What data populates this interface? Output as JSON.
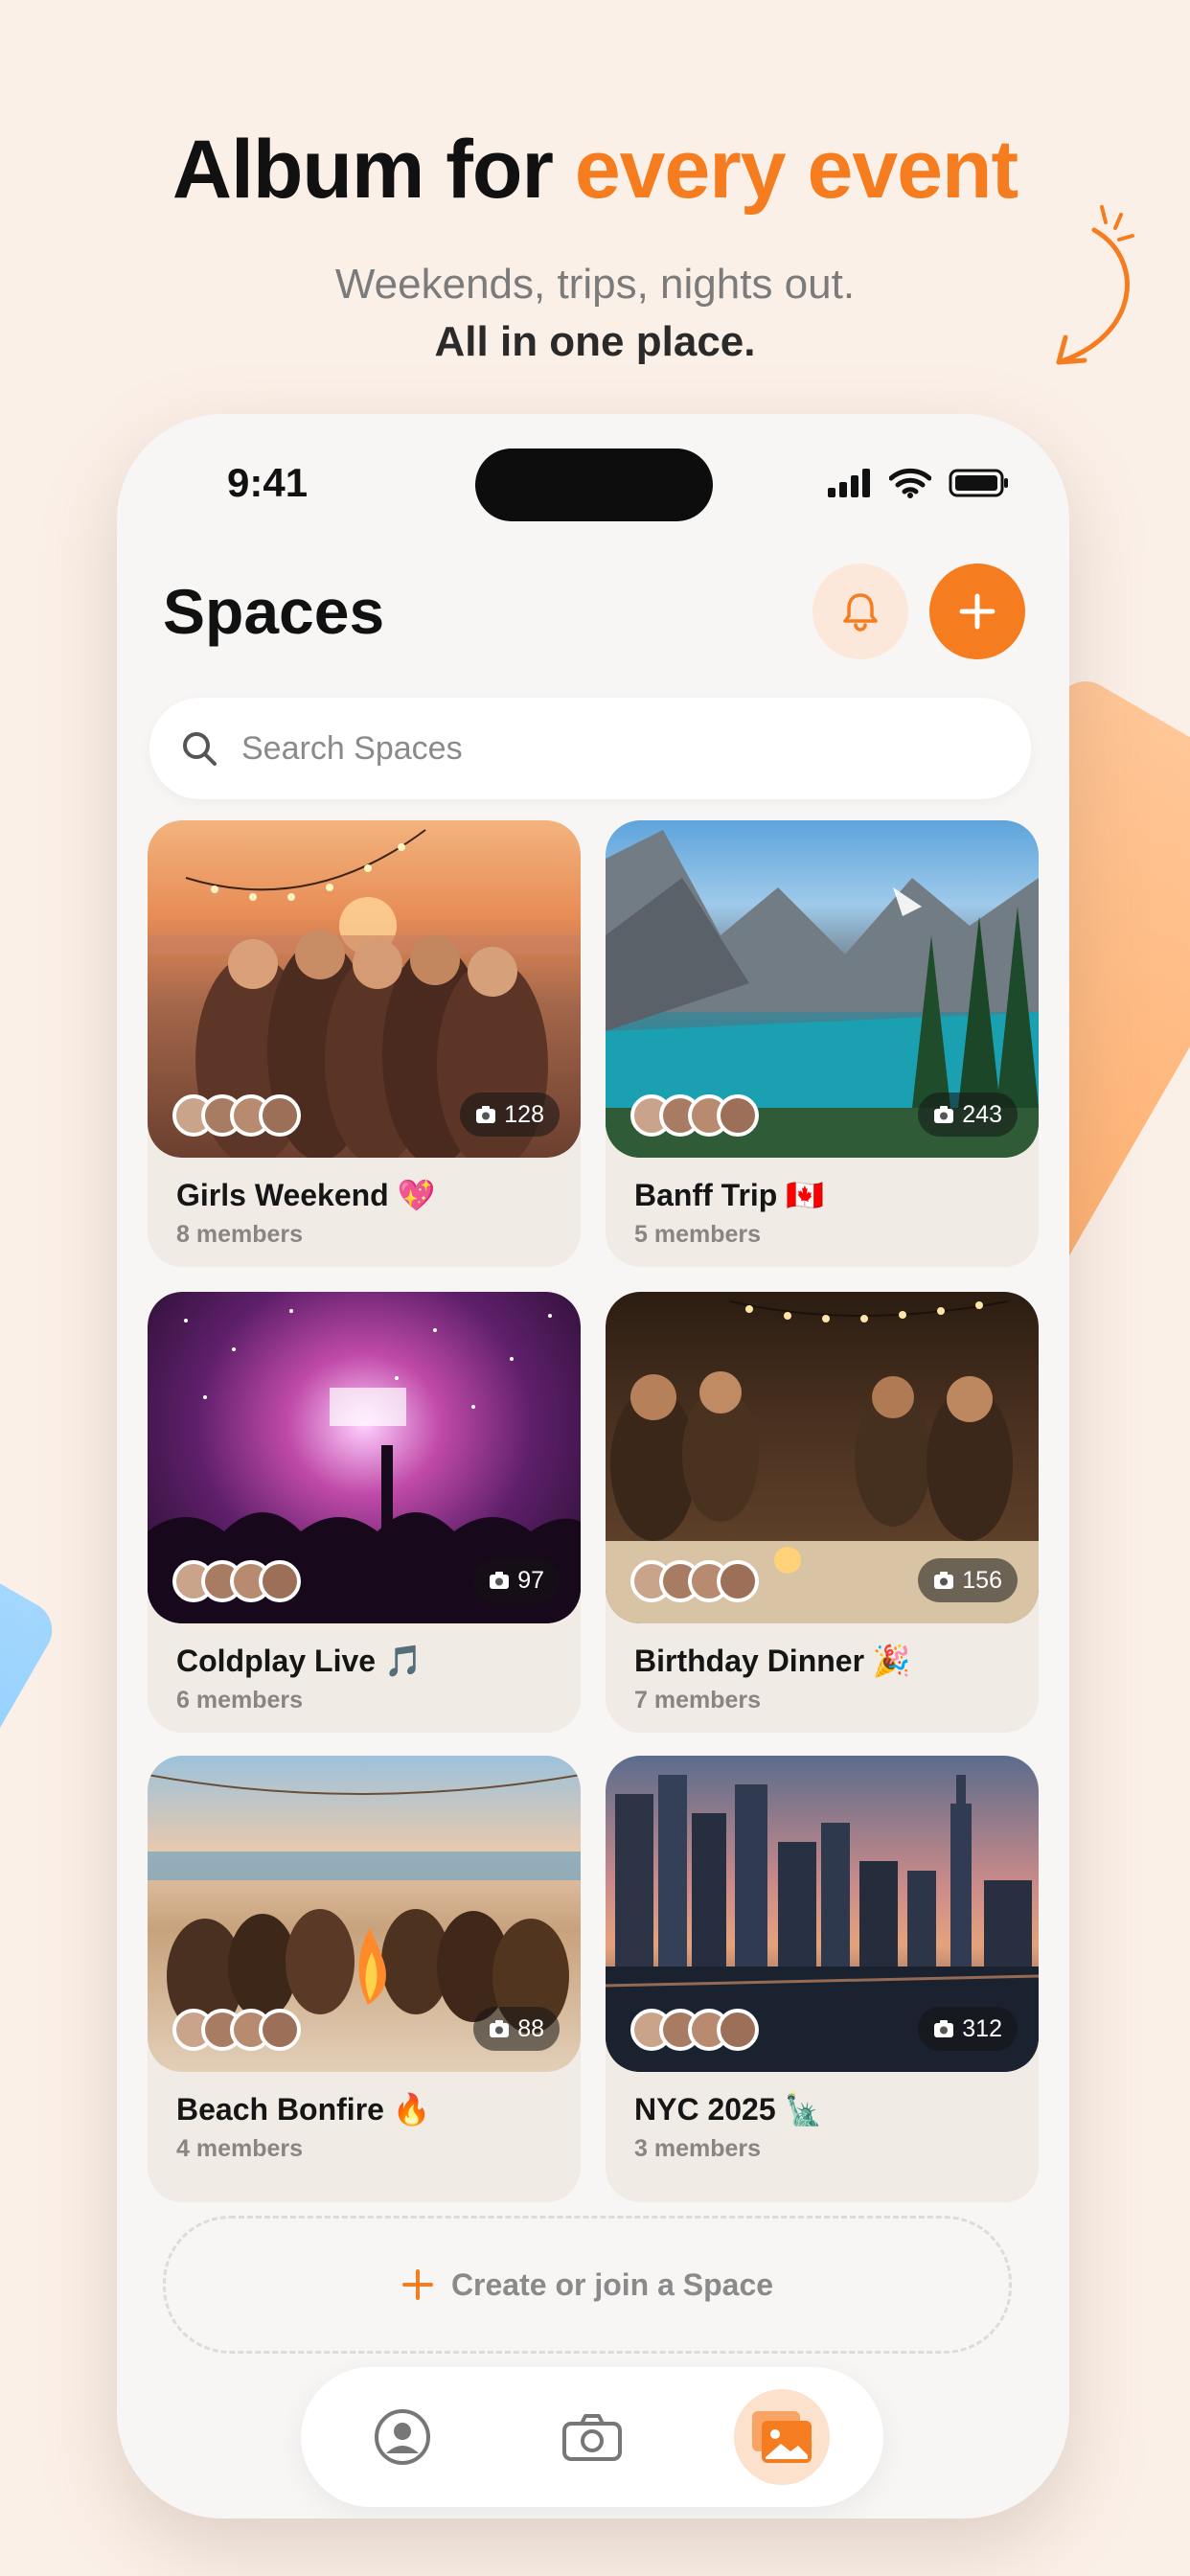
{
  "promo": {
    "headline_plain": "Album for ",
    "headline_accent": "every event",
    "subtitle_line1": "Weekends, trips, nights out.",
    "subtitle_line2": "All in one place."
  },
  "status_bar": {
    "time": "9:41"
  },
  "screen": {
    "title": "Spaces",
    "search_placeholder": "Search Spaces",
    "create_label": "Create or join a Space"
  },
  "spaces": [
    {
      "name": "Girls Weekend 💖",
      "members": "8 members",
      "photo_count": "128"
    },
    {
      "name": "Banff Trip 🇨🇦",
      "members": "5 members",
      "photo_count": "243"
    },
    {
      "name": "Coldplay Live 🎵",
      "members": "6 members",
      "photo_count": "97"
    },
    {
      "name": "Birthday Dinner 🎉",
      "members": "7 members",
      "photo_count": "156"
    },
    {
      "name": "Beach Bonfire 🔥",
      "members": "4 members",
      "photo_count": "88"
    },
    {
      "name": "NYC 2025 🗽",
      "members": "3 members",
      "photo_count": "312"
    }
  ],
  "tabs": [
    {
      "icon": "profile-icon",
      "active": false
    },
    {
      "icon": "camera-icon",
      "active": false
    },
    {
      "icon": "gallery-icon",
      "active": true
    }
  ],
  "colors": {
    "accent": "#f57c1f",
    "background": "#fbf0e8"
  }
}
